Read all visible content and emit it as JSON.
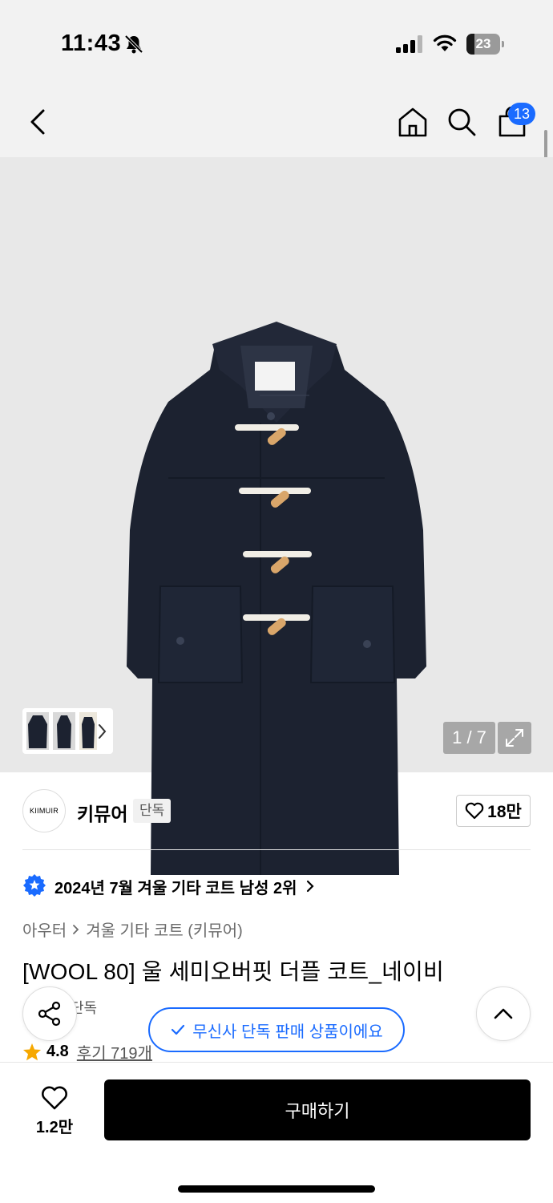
{
  "status_bar": {
    "time": "11:43",
    "battery_level": "23",
    "battery_fraction": 0.23
  },
  "header": {
    "cart_count": "13"
  },
  "gallery": {
    "page_indicator": "1 / 7"
  },
  "brand": {
    "logo_text": "KIIMUIR",
    "name": "키뮤어",
    "badge": "단독",
    "like_count": "18만"
  },
  "rank": {
    "text": "2024년 7월 겨울 기타 코트 남성 2위"
  },
  "breadcrumb": {
    "level1": "아우터",
    "level2": "겨울 기타 코트 (키뮤어)"
  },
  "product": {
    "title": "[WOOL 80] 울 세미오버핏 더플 코트_네이비",
    "badge_partial": "단독",
    "rating": "4.8",
    "reviews": "후기 719개"
  },
  "toast": {
    "text": "무신사 단독 판매 상품이에요"
  },
  "bottom_bar": {
    "wish_count": "1.2만",
    "buy_label": "구매하기"
  },
  "colors": {
    "accent_blue": "#1a6bff",
    "coat_navy": "#1c2230",
    "star": "#f6a800",
    "buy_button": "#000000"
  }
}
